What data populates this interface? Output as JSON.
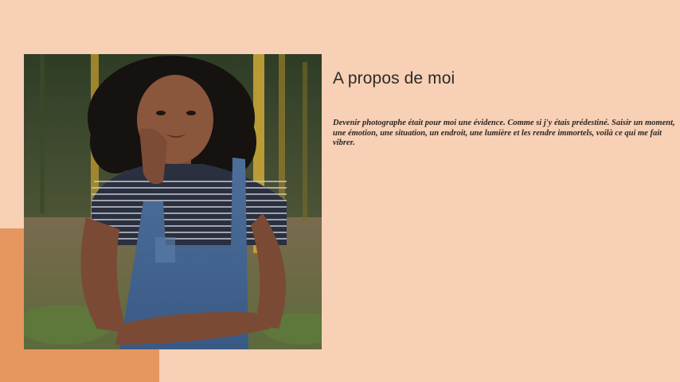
{
  "about": {
    "title": "A propos de moi",
    "bio": "Devenir photographe était pour moi une évidence. Comme si j'y étais prédestiné. Saisir un moment, une émotion, une situation, un endroit, une lumière et les rendre immortels, voilà ce qui me fait vibrer."
  },
  "colors": {
    "background": "#f7d0b5",
    "accent": "#e6965f",
    "text": "#2e2a28"
  }
}
